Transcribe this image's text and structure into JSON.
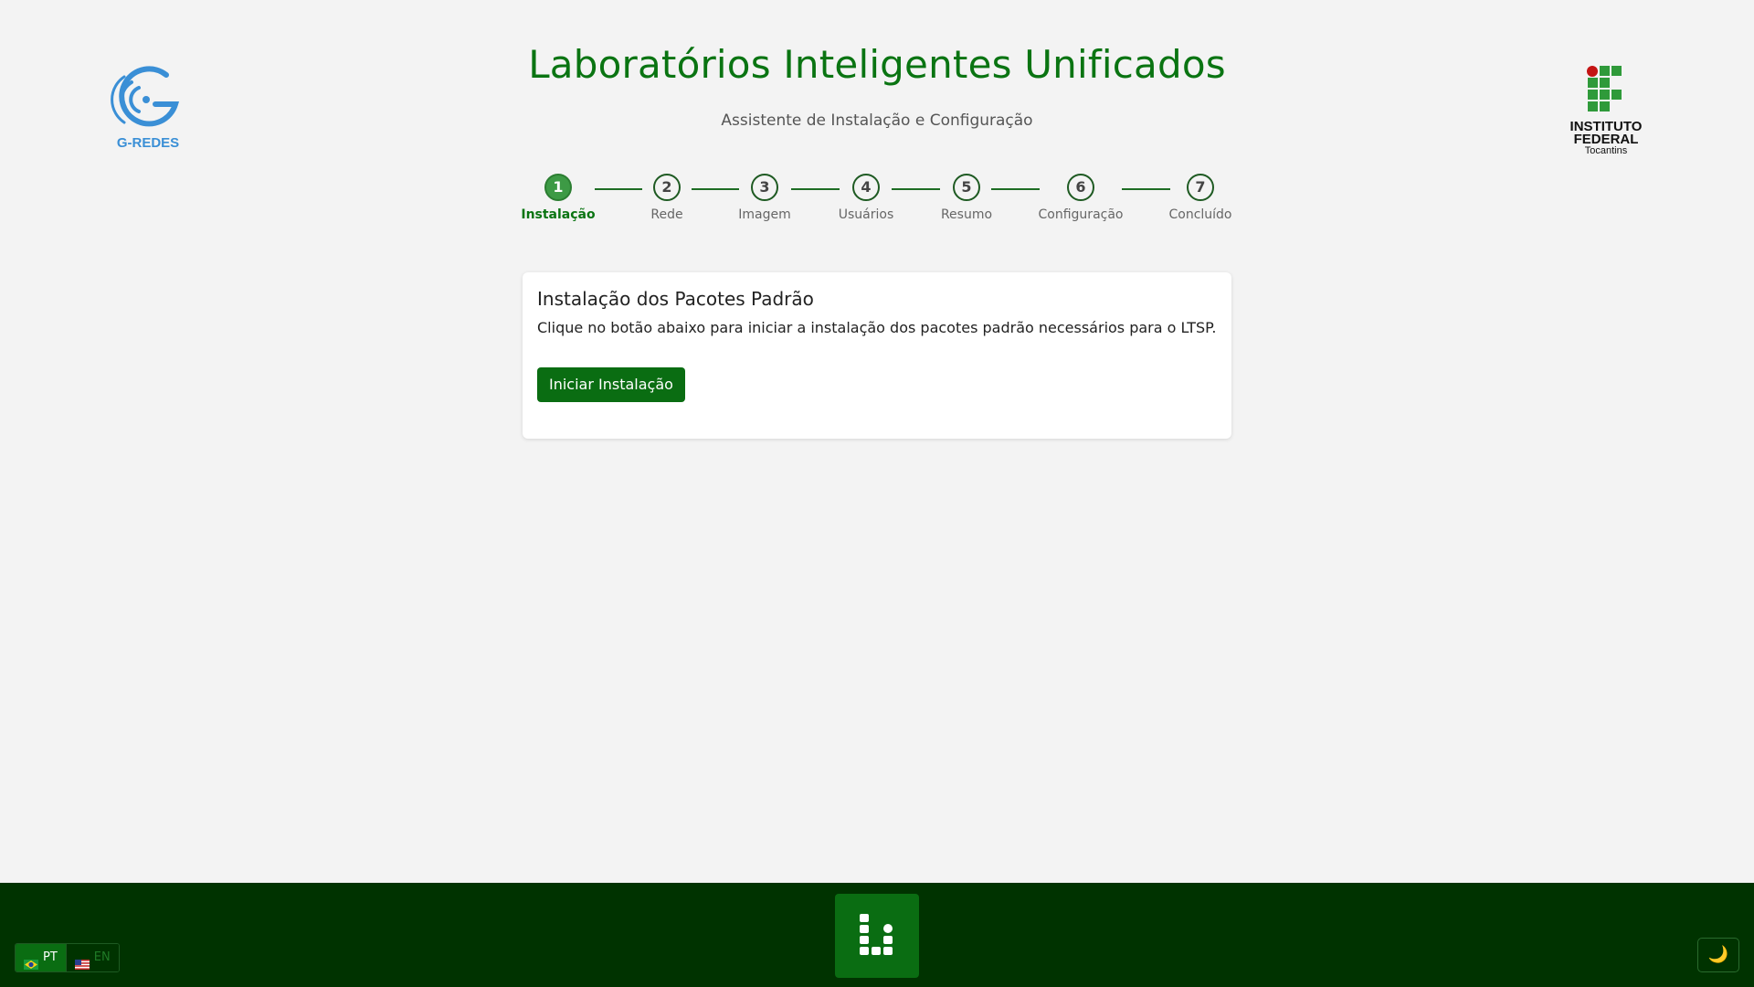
{
  "header": {
    "title": "Laboratórios Inteligentes Unificados",
    "subtitle": "Assistente de Instalação e Configuração",
    "logo_left_text": "G-REDES",
    "logo_right_lines": [
      "INSTITUTO",
      "FEDERAL",
      "Tocantins"
    ]
  },
  "stepper": {
    "active_step": 1,
    "steps": [
      {
        "number": "1",
        "label": "Instalação"
      },
      {
        "number": "2",
        "label": "Rede"
      },
      {
        "number": "3",
        "label": "Imagem"
      },
      {
        "number": "4",
        "label": "Usuários"
      },
      {
        "number": "5",
        "label": "Resumo"
      },
      {
        "number": "6",
        "label": "Configuração"
      },
      {
        "number": "7",
        "label": "Concluído"
      }
    ]
  },
  "card": {
    "title": "Instalação dos Pacotes Padrão",
    "description": "Clique no botão abaixo para iniciar a instalação dos pacotes padrão necessários para o LTSP.",
    "button_label": "Iniciar Instalação"
  },
  "footer": {
    "languages": [
      {
        "code": "PT",
        "flag": "brazil-flag-icon",
        "active": true
      },
      {
        "code": "EN",
        "flag": "us-flag-icon",
        "active": false
      }
    ],
    "theme_toggle_icon": "moon-icon",
    "center_logo_icon": "ltsp-logo-icon"
  },
  "colors": {
    "brand_green": "#0a7412",
    "button_green": "#0a6d12",
    "footer_green": "#003300",
    "active_step": "#3d9a45",
    "g_redes_blue": "#3a8fd6",
    "background": "#f3f3f3"
  }
}
